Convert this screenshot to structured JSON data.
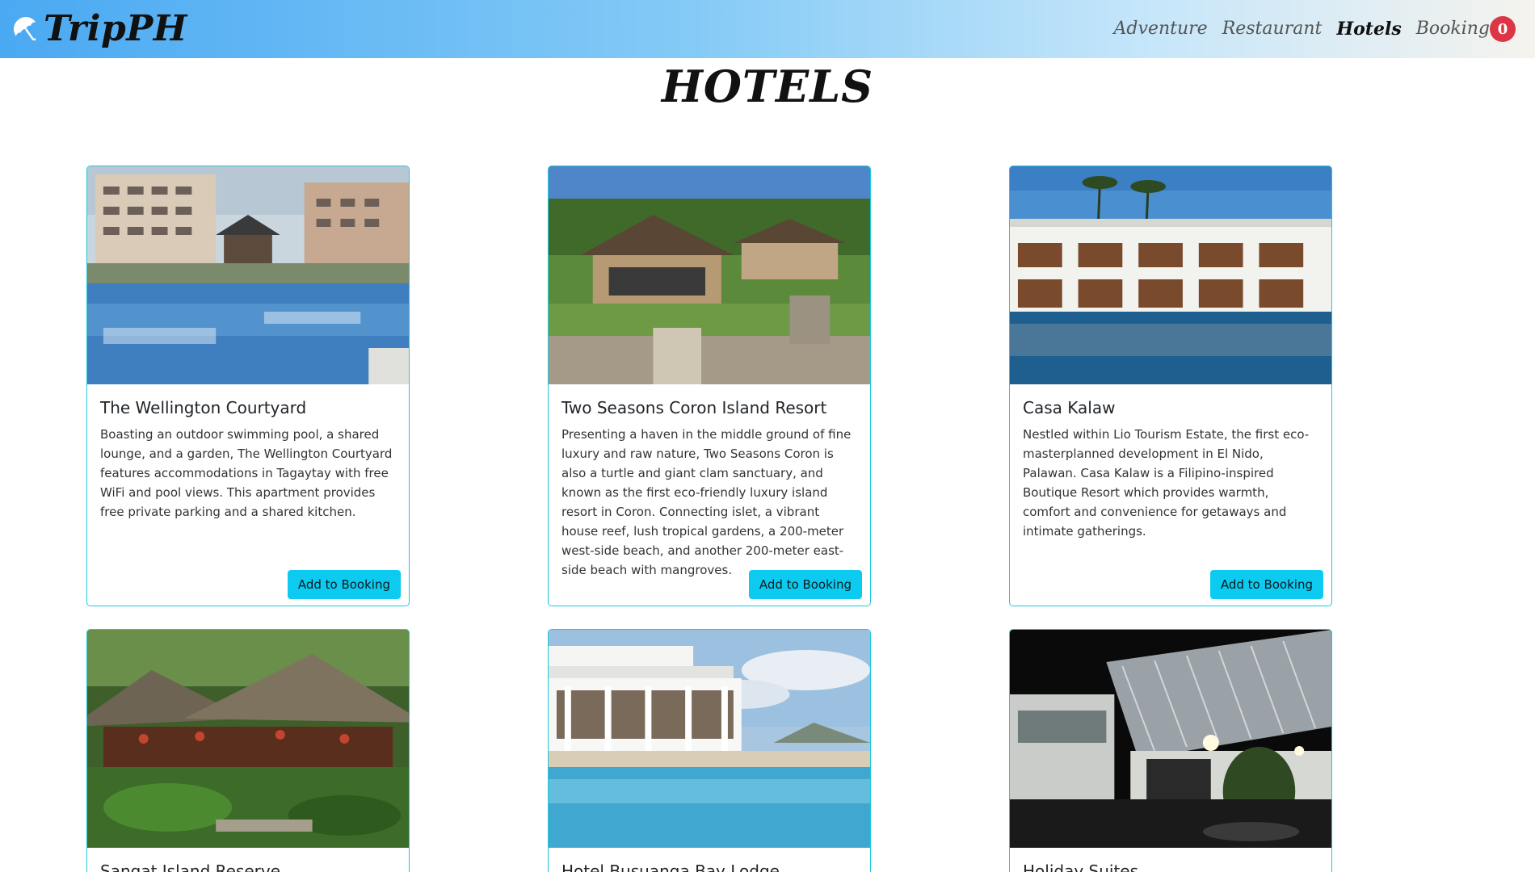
{
  "nav": {
    "brand": "TripPH",
    "links": [
      "Adventure",
      "Restaurant",
      "Hotels",
      "Booking"
    ],
    "active": "Hotels",
    "booking_count": "0"
  },
  "page": {
    "title": "HOTELS"
  },
  "colors": {
    "accent": "#0dcaf0",
    "card_border": "#1ec8dd",
    "badge": "#dc3545"
  },
  "hotels": [
    {
      "name": "The Wellington Courtyard",
      "description": "Boasting an outdoor swimming pool, a shared lounge, and a garden, The Wellington Courtyard features accommodations in Tagaytay with free WiFi and pool views. This apartment provides free private parking and a shared kitchen.",
      "button": "Add to Booking"
    },
    {
      "name": "Two Seasons Coron Island Resort",
      "description": "Presenting a haven in the middle ground of fine luxury and raw nature, Two Seasons Coron is also a turtle and giant clam sanctuary, and known as the first eco-friendly luxury island resort in Coron. Connecting islet, a vibrant house reef, lush tropical gardens, a 200-meter west-side beach, and another 200-meter east-side beach with mangroves.",
      "button": "Add to Booking"
    },
    {
      "name": "Casa Kalaw",
      "description": "Nestled within Lio Tourism Estate, the first eco-masterplanned development in El Nido, Palawan. Casa Kalaw is a Filipino-inspired Boutique Resort which provides warmth, comfort and convenience for getaways and intimate gatherings.",
      "button": "Add to Booking"
    },
    {
      "name": "Sangat Island Reserve"
    },
    {
      "name": "Hotel Busuanga Bay Lodge"
    },
    {
      "name": "Holiday Suites"
    }
  ]
}
